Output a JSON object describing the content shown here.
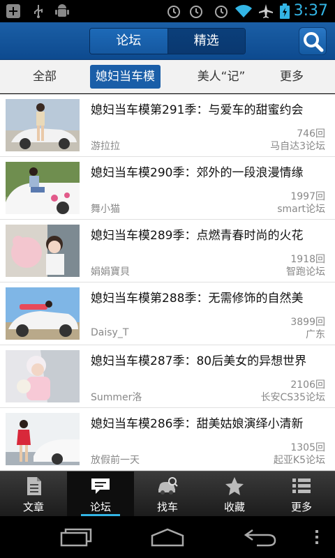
{
  "status": {
    "time": "3:37"
  },
  "header": {
    "segments": [
      "论坛",
      "精选"
    ],
    "active_segment": 0
  },
  "categories": [
    {
      "label": "全部",
      "active": false
    },
    {
      "label": "媳妇当车模",
      "active": true
    },
    {
      "label": "美人“记”",
      "active": false
    },
    {
      "label": "更多",
      "active": false
    }
  ],
  "posts": [
    {
      "title": "媳妇当车模第291季：与爱车的甜蜜约会",
      "count": "746回",
      "author": "游拉拉",
      "forum": "马自达3论坛"
    },
    {
      "title": "媳妇当车模290季：郊外的一段浪漫情缘",
      "count": "1997回",
      "author": "舞小猫",
      "forum": "smart论坛"
    },
    {
      "title": "媳妇当车模289季：点燃青春时尚的火花",
      "count": "1918回",
      "author": "娟娟寶貝",
      "forum": "智跑论坛"
    },
    {
      "title": "媳妇当车模第288季：无需修饰的自然美",
      "count": "3899回",
      "author": "Daisy_T",
      "forum": "广东"
    },
    {
      "title": "媳妇当车模287季：80后美女的异想世界",
      "count": "2106回",
      "author": "Summer洛",
      "forum": "长安CS35论坛"
    },
    {
      "title": "媳妇当车模286季：甜美姑娘演绎小清新",
      "count": "1305回",
      "author": "放假前一天",
      "forum": "起亚K5论坛"
    }
  ],
  "tabbar": [
    {
      "label": "文章",
      "icon": "article-icon",
      "active": false
    },
    {
      "label": "论坛",
      "icon": "forum-chat-icon",
      "active": true
    },
    {
      "label": "找车",
      "icon": "find-car-icon",
      "active": false
    },
    {
      "label": "收藏",
      "icon": "star-icon",
      "active": false
    },
    {
      "label": "更多",
      "icon": "more-list-icon",
      "active": false
    }
  ],
  "colors": {
    "accent": "#1a5ea8",
    "status_time": "#33b5e5",
    "tab_underline": "#33b5e5"
  }
}
